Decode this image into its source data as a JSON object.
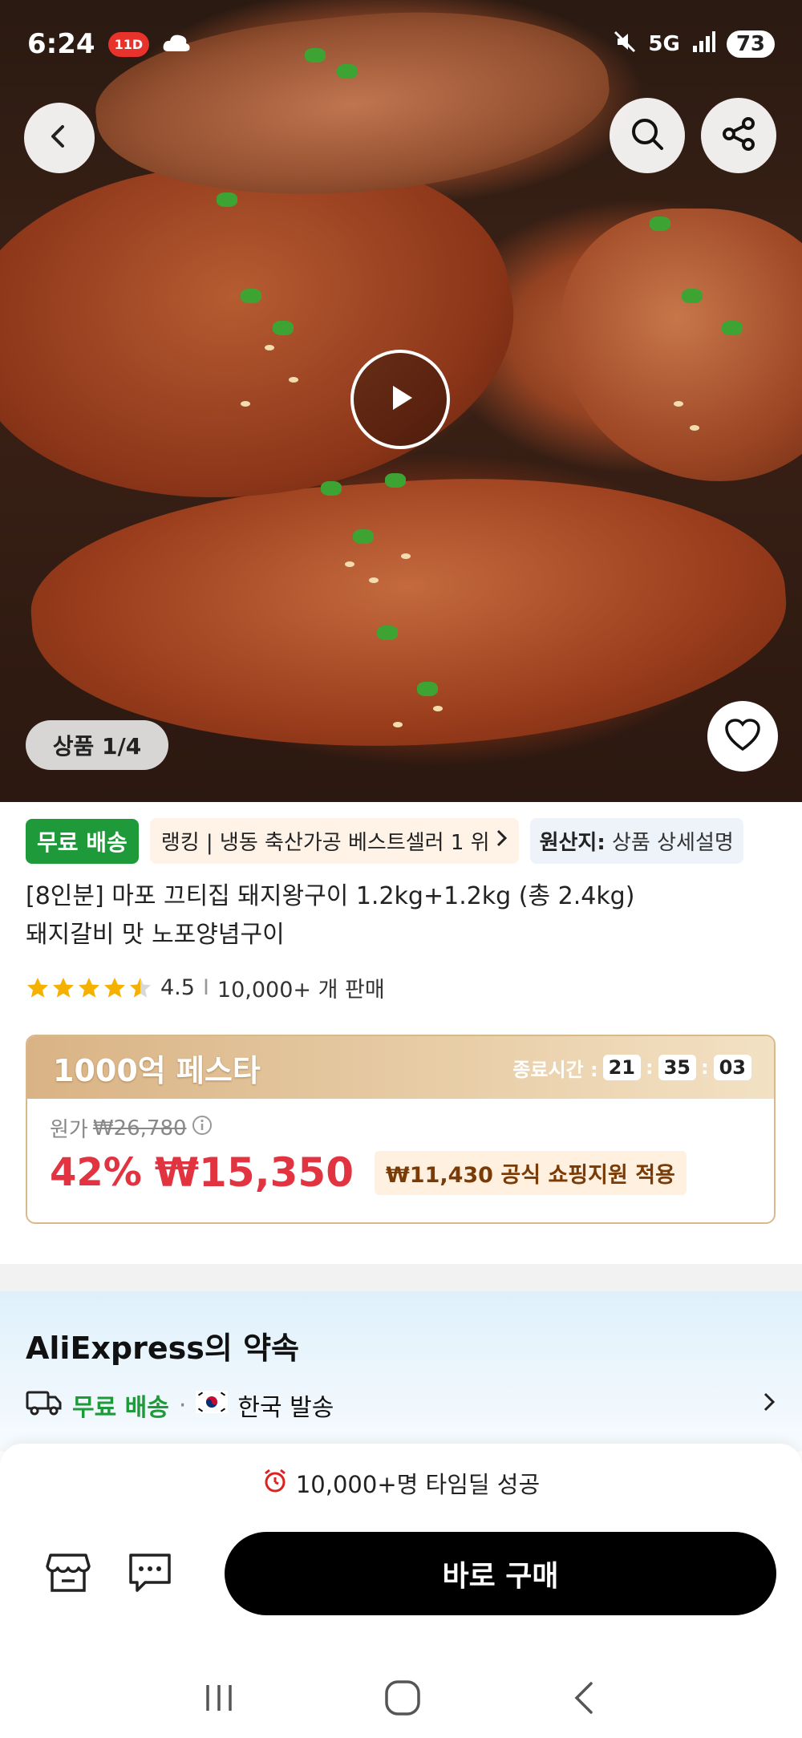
{
  "status_bar": {
    "time": "6:24",
    "badge": "11D",
    "network": "5G",
    "battery": "73"
  },
  "hero": {
    "counter": "상품 1/4"
  },
  "tags": {
    "free_shipping": "무료 배송",
    "ranking": "랭킹 | 냉동 축산가공 베스트셀러 1 위",
    "origin_label": "원산지:",
    "origin_value": "상품 상세설명"
  },
  "product": {
    "title_line1": "[8인분] 마포 끄티집 돼지왕구이 1.2kg+1.2kg (총 2.4kg)",
    "title_line2": "돼지갈비 맛 노포양념구이",
    "rating": "4.5",
    "rating_value": 4.5,
    "sold": "10,000+ 개 판매"
  },
  "deal": {
    "title": "1000억 페스타",
    "timer_label": "종료시간 :",
    "hours": "21",
    "minutes": "35",
    "seconds": "03",
    "orig_label": "원가",
    "orig_price": "₩26,780",
    "discount": "42%",
    "price": "₩15,350",
    "coupon": "₩11,430 공식 쇼핑지원 적용"
  },
  "promise": {
    "title": "AliExpress의 약속",
    "shipping_label": "무료 배송",
    "dot": "·",
    "ships_from": "한국 발송"
  },
  "bottom": {
    "timedeal": "10,000+명 타임딜 성공",
    "buy_label": "바로 구매"
  },
  "colors": {
    "accent_red": "#e23340",
    "green": "#1f9a3a",
    "gold": "#d9b385"
  }
}
